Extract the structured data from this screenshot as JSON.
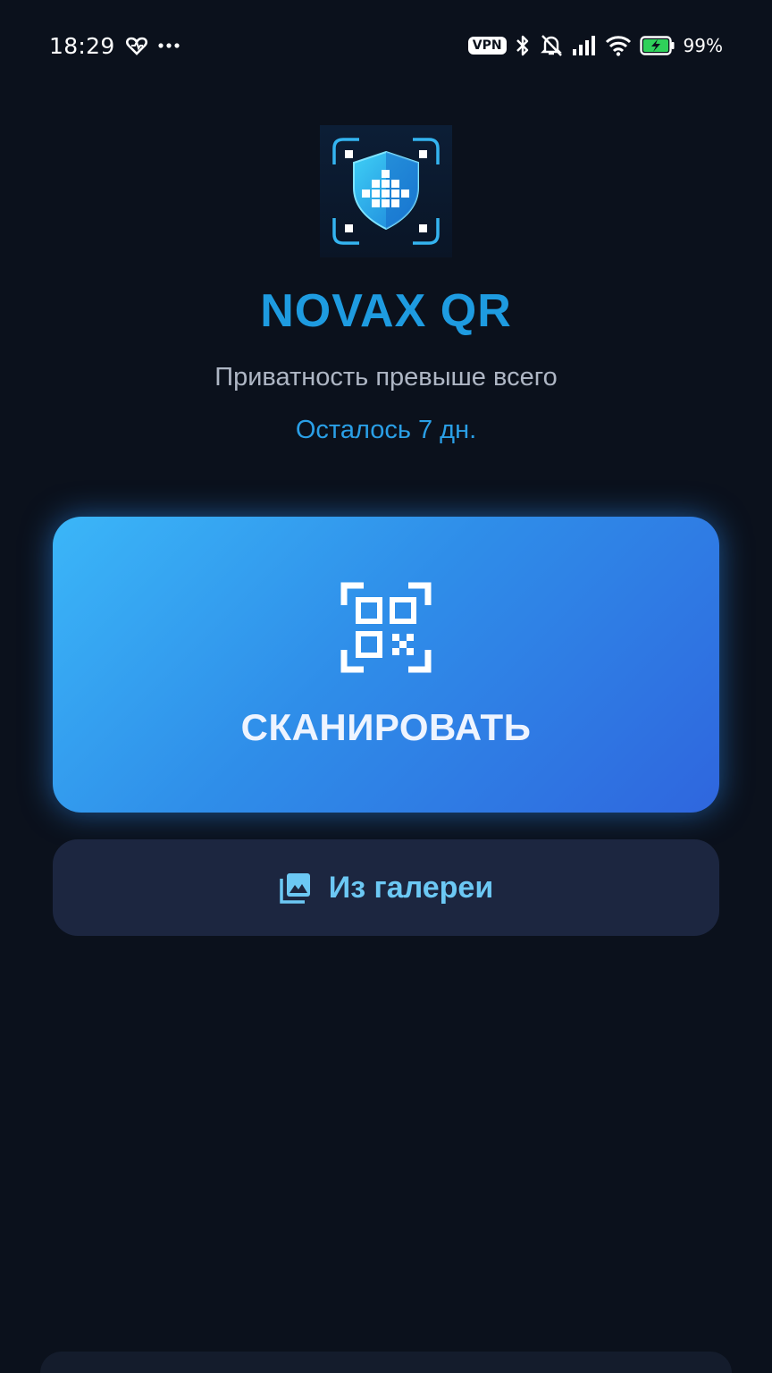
{
  "status_bar": {
    "time": "18:29",
    "vpn_label": "VPN",
    "battery_percent": "99%",
    "icons": [
      "fitness-heart-icon",
      "more-dots-icon",
      "bluetooth-icon",
      "bell-muted-icon",
      "signal-icon",
      "wifi-icon",
      "battery-charging-icon"
    ]
  },
  "app": {
    "title": "NOVAX QR",
    "subtitle": "Приватность превыше всего",
    "days_left": "Осталось 7 дн.",
    "logo_icon": "shield-qr-logo-icon"
  },
  "actions": {
    "scan_label": "СКАНИРОВАТЬ",
    "scan_icon": "qr-scan-icon",
    "gallery_label": "Из галереи",
    "gallery_icon": "gallery-icon"
  },
  "colors": {
    "background": "#0b111c",
    "accent": "#1e9be0",
    "scan_gradient_start": "#3bb6f8",
    "scan_gradient_end": "#2f66de",
    "gallery_background": "#1c2640",
    "gallery_text": "#6cc8f4"
  }
}
